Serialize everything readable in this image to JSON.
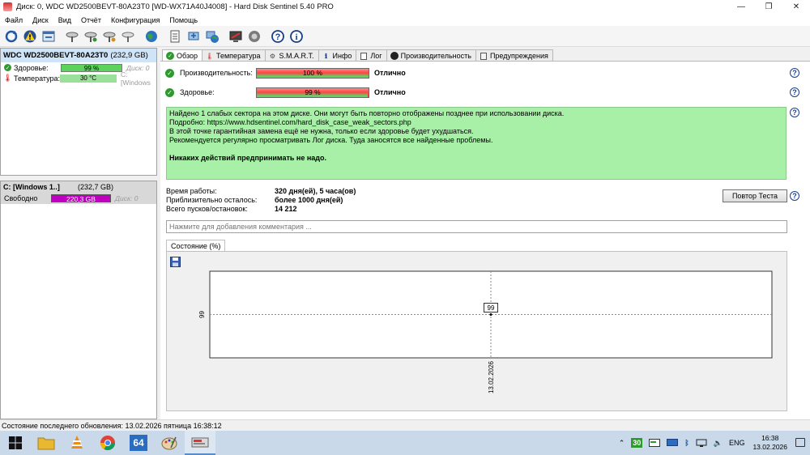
{
  "window": {
    "title": "Диск: 0, WDC WD2500BEVT-80A23T0 [WD-WX71A40J4008]  -  Hard Disk Sentinel 5.40 PRO",
    "minimize": "—",
    "restore": "❐",
    "close": "✕"
  },
  "menu": [
    "Файл",
    "Диск",
    "Вид",
    "Отчёт",
    "Конфигурация",
    "Помощь"
  ],
  "disk": {
    "name": "WDC WD2500BEVT-80A23T0",
    "size": "(232,9 GB)",
    "health_label": "Здоровье:",
    "health_value": "99 %",
    "health_pct": 99,
    "temp_label": "Температура:",
    "temp_value": "30 °C",
    "disk_note": "Диск: 0",
    "drive_note": "C: [Windows"
  },
  "partition": {
    "name": "C: [Windows 1..]",
    "size": "(232,7 GB)",
    "free_label": "Свободно",
    "free_value": "220,3 GB",
    "disk_note": "Диск: 0"
  },
  "tabs": [
    {
      "label": "Обзор",
      "icon": "check-icon"
    },
    {
      "label": "Температура",
      "icon": "thermometer-icon"
    },
    {
      "label": "S.M.A.R.T.",
      "icon": "smart-icon"
    },
    {
      "label": "Инфо",
      "icon": "info-icon"
    },
    {
      "label": "Лог",
      "icon": "log-icon"
    },
    {
      "label": "Производительность",
      "icon": "performance-icon"
    },
    {
      "label": "Предупреждения",
      "icon": "warnings-icon"
    }
  ],
  "overview": {
    "perf_label": "Производительность:",
    "perf_value": "100 %",
    "perf_pct": 100,
    "perf_status": "Отлично",
    "health_label": "Здоровье:",
    "health_value": "99 %",
    "health_pct": 99,
    "health_status": "Отлично",
    "message_lines": [
      "Найдено 1 слабых сектора на этом диске. Они могут быть повторно отображены позднее при использовании диска.",
      "Подробно: https://www.hdsentinel.com/hard_disk_case_weak_sectors.php",
      "В этой точке гарантийная замена ещё не нужна, только если здоровье будет ухудшаться.",
      "Рекомендуется регулярно просматривать Лог диска. Туда заносятся все найденные проблемы."
    ],
    "message_bold": "Никаких действий предпринимать не надо.",
    "uptime_label": "Время работы:",
    "uptime_value": "320 дня(ей), 5 часа(ов)",
    "remaining_label": "Приблизительно осталось:",
    "remaining_value": "более 1000 дня(ей)",
    "starts_label": "Всего пусков/остановок:",
    "starts_value": "14 212",
    "retest_button": "Повтор Теста",
    "comment_placeholder": "Нажмите для добавления комментария ...",
    "state_tab": "Состояние (%)"
  },
  "chart_data": {
    "type": "line",
    "x": [
      "13.02.2026"
    ],
    "series": [
      {
        "values": [
          99
        ]
      }
    ],
    "ytick_labels": [
      "99"
    ],
    "point_labels": [
      "99"
    ],
    "grid": true
  },
  "statusbar": {
    "text": "Состояние последнего обновления: 13.02.2026 пятница 16:38:12"
  },
  "taskbar": {
    "badge": "30",
    "lang": "ENG",
    "time": "16:38",
    "date": "13.02.2026",
    "app64": "64"
  },
  "colors": {
    "health_green": "#5dd35d",
    "message_bg": "#a8f0a8",
    "free_bar": "#c000c0",
    "disk_header_bg": "#cfe4f7"
  }
}
